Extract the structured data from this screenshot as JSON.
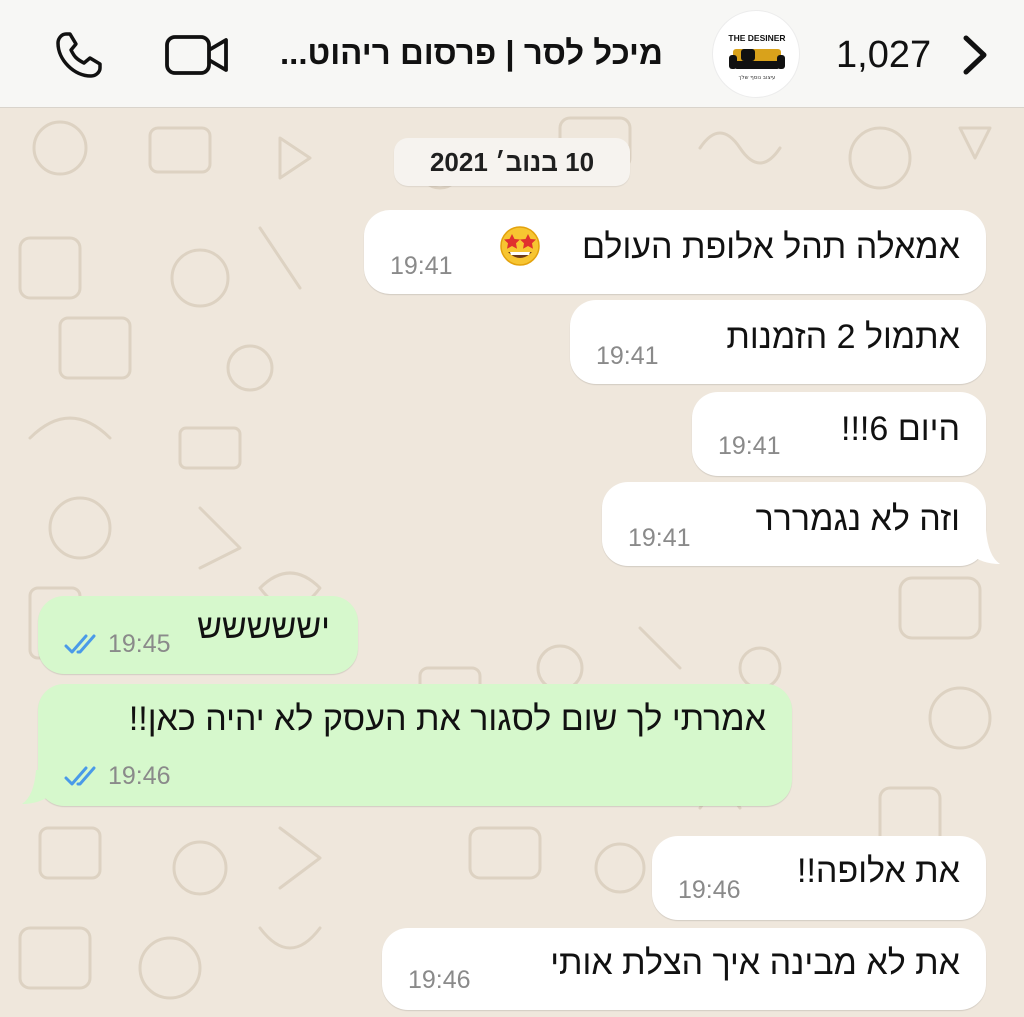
{
  "header": {
    "back_count": "1,027",
    "contact_name": "מיכל לסר | פרסום ריהוט...",
    "avatar_logo_text": "THE DESINER",
    "avatar_tagline": "עיצוב נוסף שלך"
  },
  "date_separator": "10 בנוב׳ 2021",
  "messages": [
    {
      "direction": "incoming",
      "text": "אמאלה תהל אלופת העולם",
      "emoji": "star-struck-emoji",
      "time": "19:41"
    },
    {
      "direction": "incoming",
      "text": "אתמול 2 הזמנות",
      "time": "19:41"
    },
    {
      "direction": "incoming",
      "text": "היום 6!!!",
      "time": "19:41"
    },
    {
      "direction": "incoming",
      "text": "וזה לא נגמררר",
      "time": "19:41"
    },
    {
      "direction": "outgoing",
      "text": "יששששש",
      "time": "19:45",
      "status": "read"
    },
    {
      "direction": "outgoing",
      "text": "אמרתי לך שום לסגור את העסק לא יהיה כאן!!",
      "time": "19:46",
      "status": "read"
    },
    {
      "direction": "incoming",
      "text": "את אלופה!!",
      "time": "19:46"
    },
    {
      "direction": "incoming",
      "text": "את לא מבינה איך הצלת אותי",
      "time": "19:46"
    }
  ],
  "colors": {
    "chat_background": "#efe7dc",
    "incoming_bubble": "#ffffff",
    "outgoing_bubble": "#d6f8cc",
    "read_tick": "#4a9ae8"
  }
}
